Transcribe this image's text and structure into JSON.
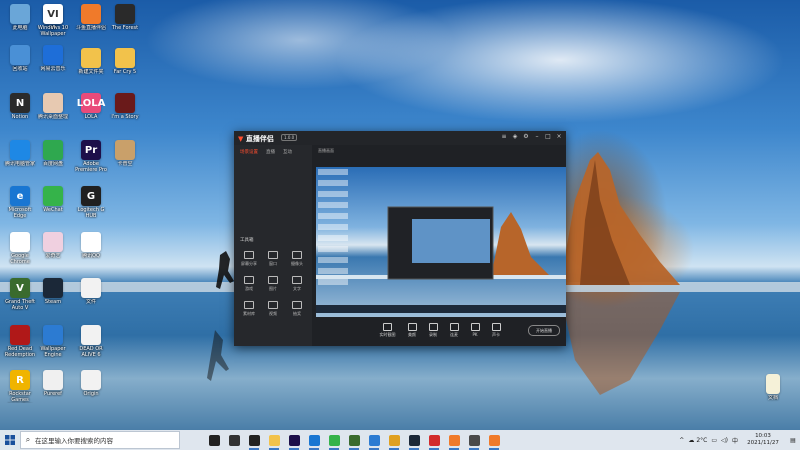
{
  "desktop": {
    "icons": [
      {
        "label": "此电脑",
        "icon": "computer-icon",
        "color": "#6aa6d8",
        "glyph": ""
      },
      {
        "label": "回收站",
        "icon": "recycle-bin-icon",
        "color": "#4a90d6",
        "glyph": ""
      },
      {
        "label": "Windows 10 Wallpaper",
        "icon": "wallpaper-app-icon",
        "color": "#2e6fb8",
        "glyph": ""
      },
      {
        "label": "新建文件夹",
        "icon": "folder-icon",
        "color": "#f2c24b",
        "glyph": ""
      },
      {
        "label": "Notion",
        "icon": "notion-icon",
        "color": "#2b2b2b",
        "glyph": "N"
      },
      {
        "label": "腾讯桌面整理",
        "icon": "anime-avatar-icon",
        "color": "#e7c9b1",
        "glyph": ""
      },
      {
        "label": "腾讯电脑管家",
        "icon": "shield-icon",
        "color": "#1e88e5",
        "glyph": ""
      },
      {
        "label": "Microsoft Edge",
        "icon": "edge-icon",
        "color": "#1976d2",
        "glyph": "e"
      },
      {
        "label": "Google Chrome",
        "icon": "chrome-icon",
        "color": "#ffffff",
        "glyph": ""
      },
      {
        "label": "Grand Theft Auto V",
        "icon": "gta-icon",
        "color": "#3a6b2e",
        "glyph": "V"
      },
      {
        "label": "Red Dead Redemption 2",
        "icon": "rdr2-icon",
        "color": "#b01818",
        "glyph": ""
      },
      {
        "label": "Rockstar Games Launcher",
        "icon": "rockstar-icon",
        "color": "#f0b400",
        "glyph": "R"
      },
      {
        "label": "VI",
        "icon": "vi-icon",
        "color": "#ffffff",
        "glyph": "VI"
      },
      {
        "label": "网易云音乐",
        "icon": "music-icon",
        "color": "#1e6ed8",
        "glyph": ""
      },
      {
        "label": "LOLA",
        "icon": "lola-icon",
        "color": "#e94b7a",
        "glyph": "LOLA"
      },
      {
        "label": "百度网盘",
        "icon": "cloud-icon",
        "color": "#2fa84f",
        "glyph": ""
      },
      {
        "label": "WeChat",
        "icon": "wechat-icon",
        "color": "#35b34a",
        "glyph": ""
      },
      {
        "label": "爱奇艺",
        "icon": "anime-girl-icon",
        "color": "#f0d0e0",
        "glyph": ""
      },
      {
        "label": "Steam",
        "icon": "steam-icon",
        "color": "#1b2838",
        "glyph": ""
      },
      {
        "label": "Wallpaper Engine",
        "icon": "wallpaper-engine-icon",
        "color": "#2c7bd2",
        "glyph": ""
      },
      {
        "label": "Pureref",
        "icon": "file-icon",
        "color": "#f0f0f0",
        "glyph": ""
      },
      {
        "label": "斗鱼直播伴侣",
        "icon": "douyu-icon",
        "color": "#f07a2a",
        "glyph": ""
      },
      {
        "label": "Adobe Premiere Pro",
        "icon": "premiere-icon",
        "color": "#1d0f4a",
        "glyph": "Pr"
      },
      {
        "label": "Logitech G HUB",
        "icon": "logitech-icon",
        "color": "#202020",
        "glyph": "G"
      },
      {
        "label": "腾讯QQ",
        "icon": "qq-icon",
        "color": "#ffffff",
        "glyph": ""
      },
      {
        "label": "文件",
        "icon": "file-icon",
        "color": "#f2f2f2",
        "glyph": ""
      },
      {
        "label": "DEAD OR ALIVE 6",
        "icon": "file-icon",
        "color": "#f2f2f2",
        "glyph": ""
      },
      {
        "label": "Origin",
        "icon": "origin-icon",
        "color": "#f2f2f2",
        "glyph": ""
      },
      {
        "label": "The Forest",
        "icon": "forest-icon",
        "color": "#2a2a2a",
        "glyph": ""
      },
      {
        "label": "Far Cry 5",
        "icon": "folder-icon",
        "color": "#f2c24b",
        "glyph": ""
      },
      {
        "label": "I'm a Story",
        "icon": "game-icon",
        "color": "#6a1a1a",
        "glyph": ""
      },
      {
        "label": "卡普空",
        "icon": "character-icon",
        "color": "#c9a06a",
        "glyph": ""
      },
      {
        "label": "文档",
        "icon": "text-file-icon",
        "color": "#f5f1d8",
        "glyph": ""
      }
    ]
  },
  "app": {
    "brand": "直播伴侣",
    "version": "1.0.0",
    "sidebar_tabs": [
      "场景设置",
      "直播",
      "互动"
    ],
    "tool_section": "工具箱",
    "tools": [
      "屏幕分享",
      "窗口",
      "摄像头",
      "游戏",
      "图片",
      "文字",
      "素材库",
      "视频",
      "抽奖"
    ],
    "preview_header": "直播画面",
    "controls": [
      "实时截图",
      "美颜",
      "录制",
      "连麦",
      "PK",
      "声卡"
    ],
    "start_button": "开始直播"
  },
  "taskbar": {
    "search_placeholder": "在这里输入你要搜索的内容",
    "apps": [
      {
        "icon": "task-view-icon",
        "color": "#222"
      },
      {
        "icon": "settings-icon",
        "color": "#333"
      },
      {
        "icon": "notion-icon",
        "color": "#222"
      },
      {
        "icon": "file-explorer-icon",
        "color": "#f2c24b"
      },
      {
        "icon": "premiere-icon",
        "color": "#1d0f4a"
      },
      {
        "icon": "edge-icon",
        "color": "#1976d2"
      },
      {
        "icon": "wechat-icon",
        "color": "#35b34a"
      },
      {
        "icon": "gta-icon",
        "color": "#3a6b2e"
      },
      {
        "icon": "mail-icon",
        "color": "#2c7bd2"
      },
      {
        "icon": "chrome-icon",
        "color": "#e0a020"
      },
      {
        "icon": "steam-icon",
        "color": "#1b2838"
      },
      {
        "icon": "netease-music-icon",
        "color": "#d22b2b"
      },
      {
        "icon": "douyu-icon",
        "color": "#f07a2a"
      },
      {
        "icon": "gamepad-icon",
        "color": "#4a4a4a"
      },
      {
        "icon": "live-companion-icon",
        "color": "#f07a2a"
      }
    ],
    "weather": "2°C",
    "ime": "中",
    "time": "10:03",
    "date": "2021/11/27"
  },
  "colors": {
    "accent": "#ff4d2e",
    "taskbar": "#dfe6ee",
    "app_bg": "#1f2125"
  }
}
